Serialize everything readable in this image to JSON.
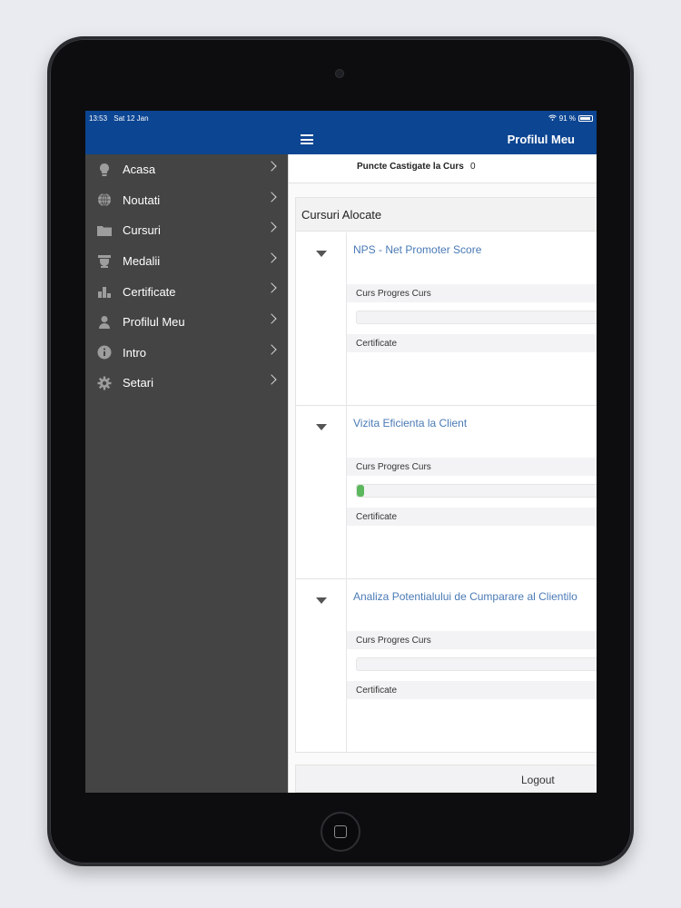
{
  "status_bar": {
    "time": "13:53",
    "date": "Sat 12 Jan",
    "battery": "91 %"
  },
  "header": {
    "title": "Profilul Meu",
    "menu_icon": "hamburger-menu-icon"
  },
  "sidebar": {
    "items": [
      {
        "label": "Acasa",
        "icon": "lightbulb-icon"
      },
      {
        "label": "Noutati",
        "icon": "globe-icon"
      },
      {
        "label": "Cursuri",
        "icon": "folder-icon"
      },
      {
        "label": "Medalii",
        "icon": "trophy-icon"
      },
      {
        "label": "Certificate",
        "icon": "bar-chart-icon"
      },
      {
        "label": "Profilul Meu",
        "icon": "user-icon"
      },
      {
        "label": "Intro",
        "icon": "info-icon"
      },
      {
        "label": "Setari",
        "icon": "gear-icon"
      }
    ]
  },
  "points": {
    "label": "Puncte Castigate la Curs",
    "value": "0"
  },
  "assigned": {
    "heading": "Cursuri Alocate",
    "progress_label": "Curs Progres Curs",
    "certificate_label": "Certificate",
    "courses": [
      {
        "title": "NPS - Net Promoter Score",
        "progress": 0
      },
      {
        "title": "Vizita Eficienta la Client",
        "progress": 0.03
      },
      {
        "title": "Analiza Potentialului de Cumparare al Clientilo",
        "progress": 0
      }
    ]
  },
  "logout": {
    "label": "Logout"
  },
  "colors": {
    "header": "#0c4592",
    "sidebar": "#444444",
    "link": "#4a7ab5",
    "progress": "#5cb85c"
  }
}
